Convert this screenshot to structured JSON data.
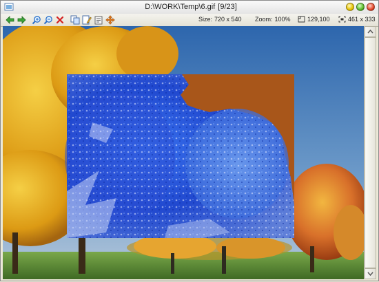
{
  "window": {
    "title": "D:\\WORK\\Temp\\6.gif",
    "counter": "[9/23]"
  },
  "status": {
    "size_label": "Size:",
    "size_value": "720 x 540",
    "zoom_label": "Zoom:",
    "zoom_value": "100%",
    "position_value": "129,100",
    "selection_value": "461 x 333"
  },
  "toolbar": {
    "icons": [
      "back-arrow-icon",
      "forward-arrow-icon",
      "zoom-in-icon",
      "zoom-out-icon",
      "delete-icon",
      "copy-icon",
      "edit-icon",
      "info-icon",
      "move-icon"
    ]
  },
  "colors": {
    "sky": "#5a8cc4",
    "foliage_yellow": "#e3a51a",
    "foliage_orange": "#d2631c",
    "selection_fill": "#a8561a",
    "inverted_blue": "#2a52e0"
  }
}
